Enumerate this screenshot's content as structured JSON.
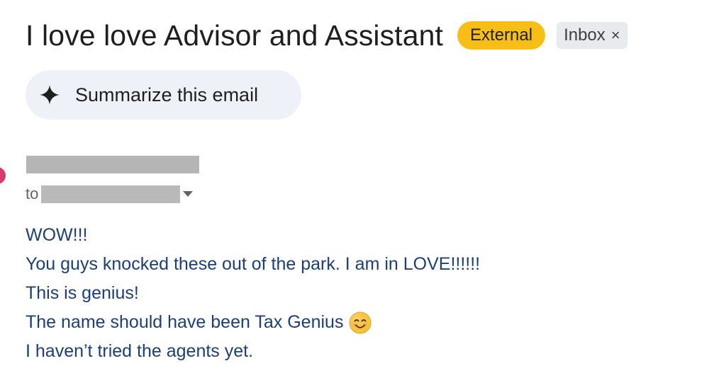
{
  "email": {
    "subject": "I love love Advisor and Assistant",
    "labels": {
      "external": "External",
      "inbox": "Inbox",
      "inbox_remove_glyph": "×"
    },
    "summarize_button_label": "Summarize this email",
    "to_label": "to",
    "body_lines": [
      "WOW!!!",
      "You guys knocked these out of the park. I am in LOVE!!!!!!",
      "This is genius!",
      "The name should have been Tax Genius",
      "I haven’t tried the agents yet."
    ],
    "emoji_icon": "smiling-face-icon"
  },
  "colors": {
    "external_badge": "#f7bf16",
    "inbox_badge": "#e8eaed",
    "summarize_button_bg": "#eef2f8",
    "body_text": "#1c3f7a",
    "redaction": "#b5b5b5",
    "avatar": "#d93a6a"
  }
}
